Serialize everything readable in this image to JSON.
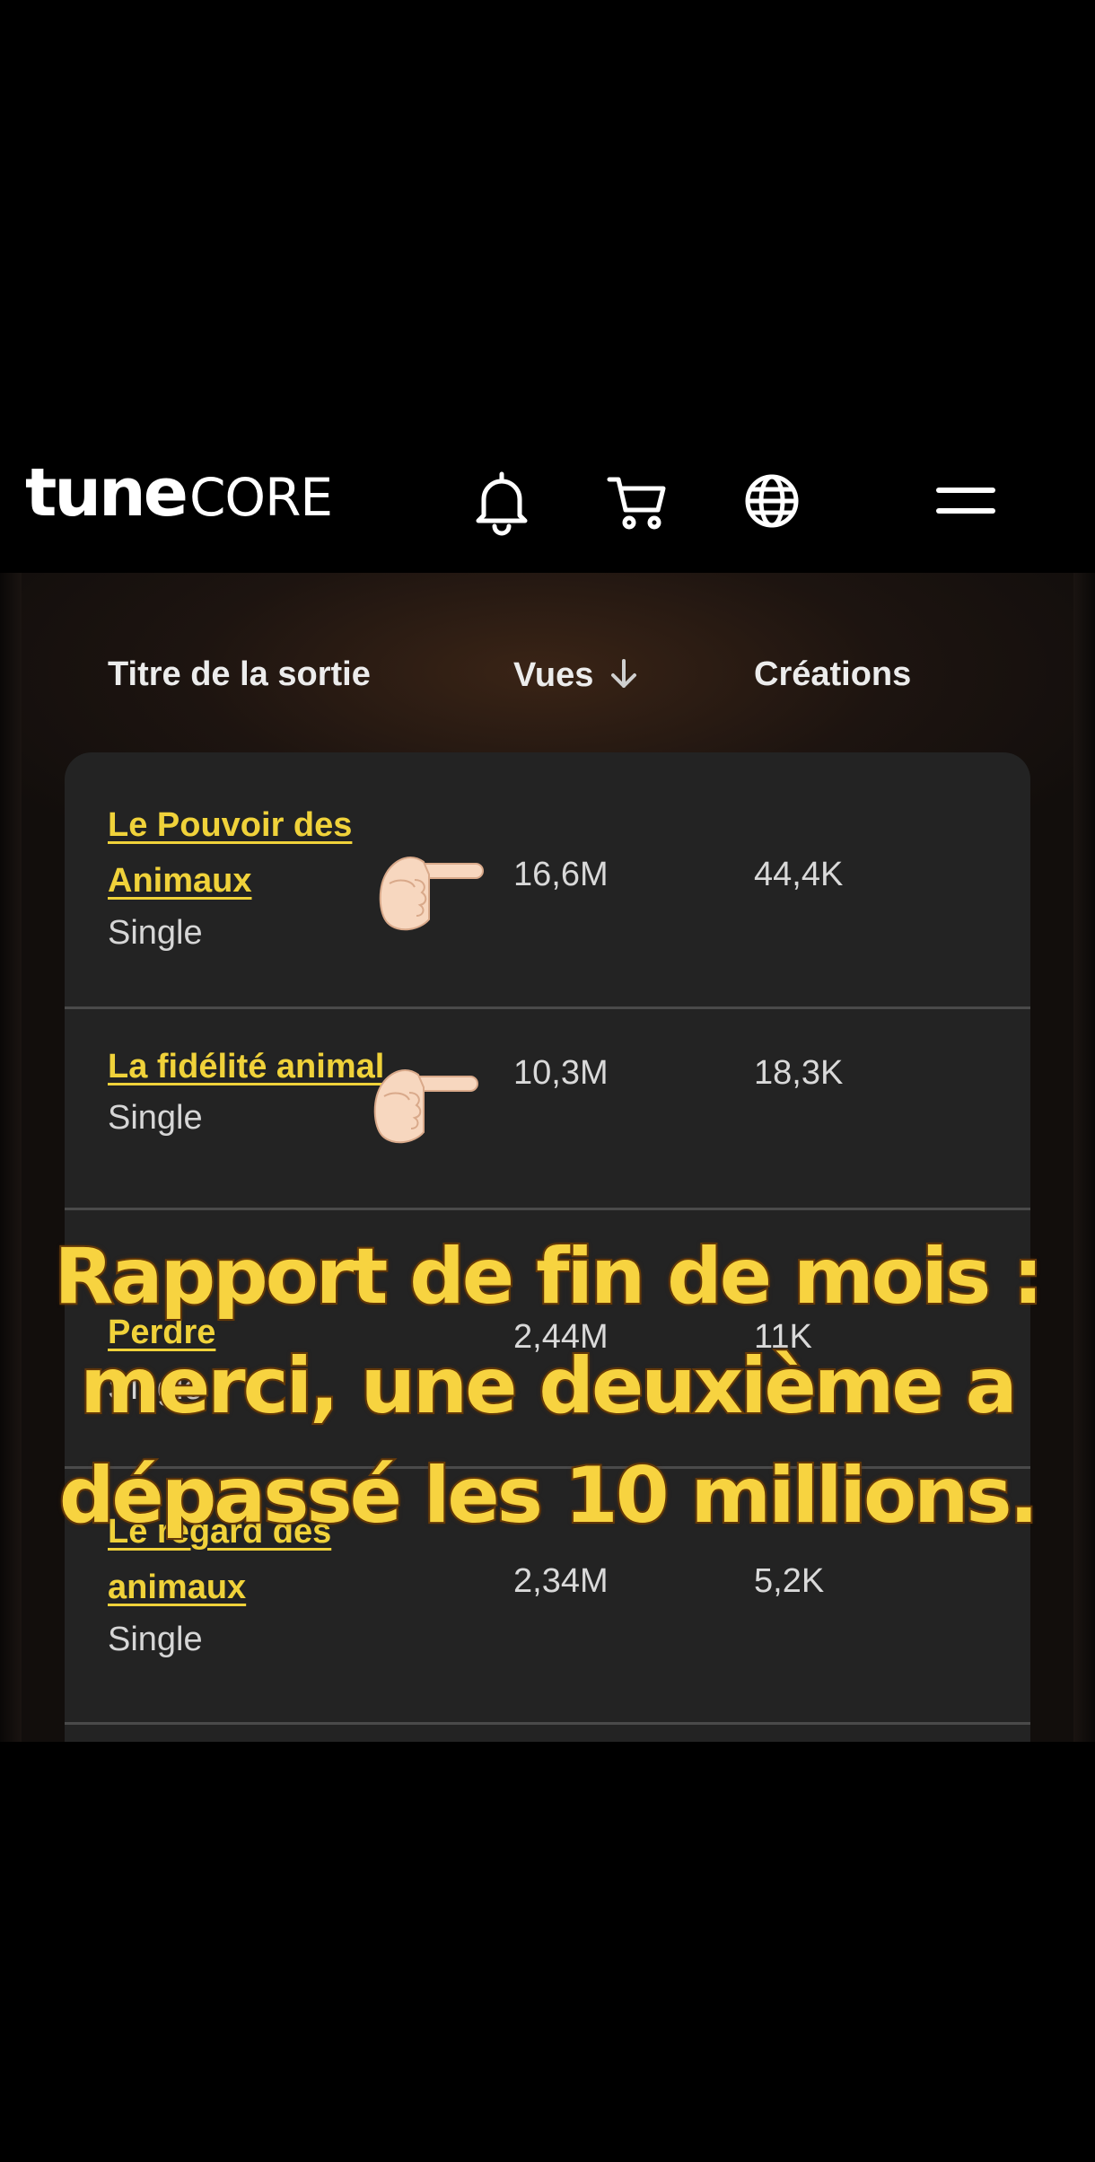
{
  "header": {
    "logo_tune": "tune",
    "logo_core": "CORE",
    "icons": [
      "bell-icon",
      "cart-icon",
      "globe-icon",
      "menu-icon"
    ]
  },
  "table": {
    "columns": {
      "title": "Titre de la sortie",
      "views": "Vues",
      "creations": "Créations"
    },
    "sort_icon": "arrow-down-icon",
    "rows": [
      {
        "title_line1": "Le Pouvoir des",
        "title_line2": "Animaux",
        "type": "Single",
        "views": "16,6M",
        "creations": "44,4K"
      },
      {
        "title_line1": "La fidélité animal",
        "title_line2": "",
        "type": "Single",
        "views": "10,3M",
        "creations": "18,3K"
      },
      {
        "title_line1": "Perdre",
        "title_line2": "",
        "type": "Single",
        "views": "2,44M",
        "creations": "11K"
      },
      {
        "title_line1": "Le regard des",
        "title_line2": "animaux",
        "type": "Single",
        "views": "2,34M",
        "creations": "5,2K"
      }
    ]
  },
  "overlay": {
    "line1": "Rapport de fin de mois :",
    "line2": "merci, une deuxième a",
    "line3": "dépassé les 10 millions."
  },
  "colors": {
    "title_link": "#f0d23a",
    "overlay_text": "#f7d340",
    "overlay_outline": "#6b3d0b",
    "card_bg": "#232323"
  }
}
